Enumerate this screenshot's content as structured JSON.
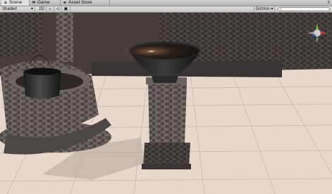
{
  "tabs": [
    {
      "label": "Scene",
      "icon": "scene-icon",
      "active": true
    },
    {
      "label": "Game",
      "icon": "game-icon",
      "active": false
    },
    {
      "label": "Asset Store",
      "icon": "asset-store-icon",
      "active": false
    }
  ],
  "toolbar": {
    "shading_mode": "Shaded",
    "mode_2d": "2D",
    "lighting_toggle": "☼",
    "audio_toggle": "◁",
    "effects_toggle": "▣",
    "gizmos": "Gizmos ▾",
    "search_placeholder": "All"
  },
  "gizmo": {
    "projection_label": "Persp",
    "x_color": "#d53a2a",
    "y_color": "#6fbf3b",
    "z_color": "#3c6fd6"
  }
}
